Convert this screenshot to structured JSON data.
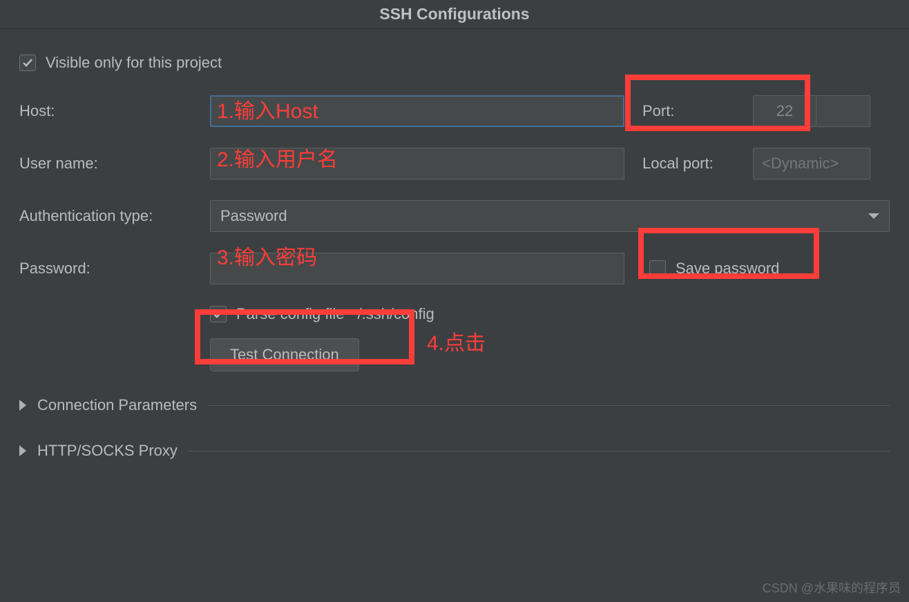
{
  "titlebar": {
    "title": "SSH Configurations"
  },
  "form": {
    "visible_only_label": "Visible only for this project",
    "visible_only_checked": true,
    "host_label": "Host:",
    "host_value": "",
    "port_label": "Port:",
    "port_value": "22",
    "username_label": "User name:",
    "username_value": "",
    "local_port_label": "Local port:",
    "local_port_placeholder": "<Dynamic>",
    "auth_type_label": "Authentication type:",
    "auth_type_value": "Password",
    "password_label": "Password:",
    "password_value": "",
    "save_password_label": "Save password",
    "save_password_checked": false,
    "parse_config_label": "Parse config file ~/.ssh/config",
    "parse_config_checked": true,
    "test_connection_label": "Test Connection",
    "section_conn_params": "Connection Parameters",
    "section_proxy": "HTTP/SOCKS Proxy"
  },
  "annotations": {
    "a1": "1.输入Host",
    "a2": "2.输入用户名",
    "a3": "3.输入密码",
    "a4": "4.点击"
  },
  "watermark": "CSDN @水果味的程序员"
}
